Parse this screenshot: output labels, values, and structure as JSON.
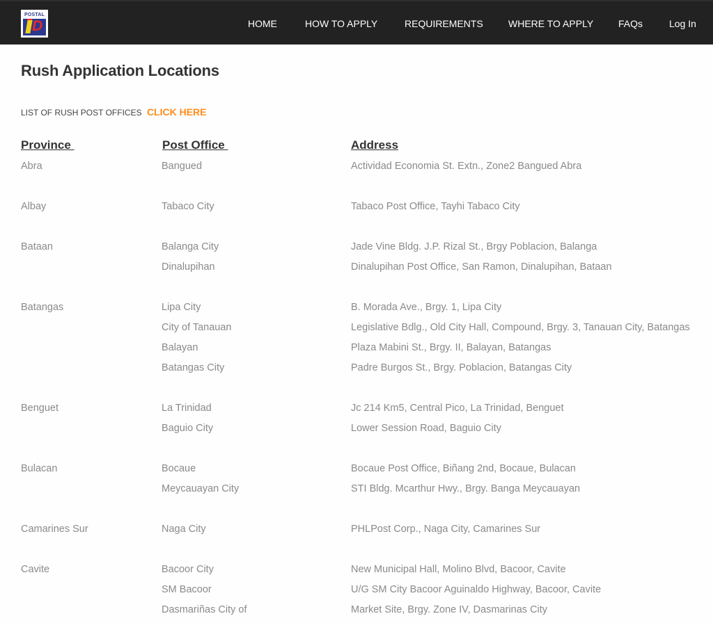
{
  "header": {
    "logo": {
      "top_text": "POSTAL",
      "mark": "iD"
    },
    "nav": [
      {
        "label": "HOME"
      },
      {
        "label": "HOW TO APPLY"
      },
      {
        "label": "REQUIREMENTS"
      },
      {
        "label": "WHERE TO APPLY"
      },
      {
        "label": "FAQs"
      },
      {
        "label": "Log In"
      }
    ]
  },
  "main": {
    "title": "Rush Application Locations",
    "rush_list_label": "LIST OF RUSH POST OFFICES",
    "rush_list_cta": "CLICK HERE",
    "columns": {
      "province": "Province ",
      "post_office": "Post Office ",
      "address": "Address"
    },
    "groups": [
      {
        "province": "Abra",
        "offices": [
          {
            "post_office": "Bangued",
            "address": "Actividad Economia St. Extn., Zone2 Bangued Abra"
          }
        ]
      },
      {
        "province": "Albay",
        "offices": [
          {
            "post_office": "Tabaco City",
            "address": "Tabaco Post Office, Tayhi Tabaco City"
          }
        ]
      },
      {
        "province": "Bataan",
        "offices": [
          {
            "post_office": "Balanga City",
            "address": "Jade Vine Bldg. J.P. Rizal St., Brgy Poblacion, Balanga"
          },
          {
            "post_office": "Dinalupihan",
            "address": "Dinalupihan Post Office, San Ramon, Dinalupihan, Bataan"
          }
        ]
      },
      {
        "province": "Batangas",
        "offices": [
          {
            "post_office": "Lipa City",
            "address": "B. Morada Ave., Brgy. 1, Lipa City"
          },
          {
            "post_office": "City of Tanauan",
            "address": "Legislative Bdlg., Old City Hall, Compound, Brgy. 3, Tanauan City, Batangas"
          },
          {
            "post_office": "Balayan",
            "address": "Plaza Mabini St., Brgy. II, Balayan, Batangas"
          },
          {
            "post_office": "Batangas City",
            "address": "Padre Burgos St., Brgy. Poblacion, Batangas City"
          }
        ]
      },
      {
        "province": "Benguet",
        "offices": [
          {
            "post_office": "La Trinidad",
            "address": "Jc 214 Km5, Central Pico, La Trinidad, Benguet"
          },
          {
            "post_office": "Baguio City",
            "address": "Lower Session Road, Baguio City"
          }
        ]
      },
      {
        "province": "Bulacan",
        "offices": [
          {
            "post_office": "Bocaue",
            "address": "Bocaue Post Office, Biñang 2nd, Bocaue, Bulacan"
          },
          {
            "post_office": "Meycauayan City",
            "address": "STI Bldg. Mcarthur Hwy., Brgy. Banga Meycauayan"
          }
        ]
      },
      {
        "province": "Camarines Sur",
        "offices": [
          {
            "post_office": "Naga City",
            "address": "PHLPost Corp., Naga City, Camarines Sur"
          }
        ]
      },
      {
        "province": "Cavite",
        "offices": [
          {
            "post_office": "Bacoor City",
            "address": "New Municipal Hall, Molino Blvd, Bacoor, Cavite"
          },
          {
            "post_office": "SM Bacoor",
            "address": "U/G SM City Bacoor Aguinaldo Highway, Bacoor, Cavite"
          },
          {
            "post_office": "Dasmariñas City of",
            "address": "Market Site, Brgy. Zone IV, Dasmarinas City"
          }
        ]
      }
    ]
  },
  "colors": {
    "header_bg": "#222222",
    "accent": "#ff8c1a",
    "title": "#333333",
    "body_text": "#8a8a8a"
  }
}
